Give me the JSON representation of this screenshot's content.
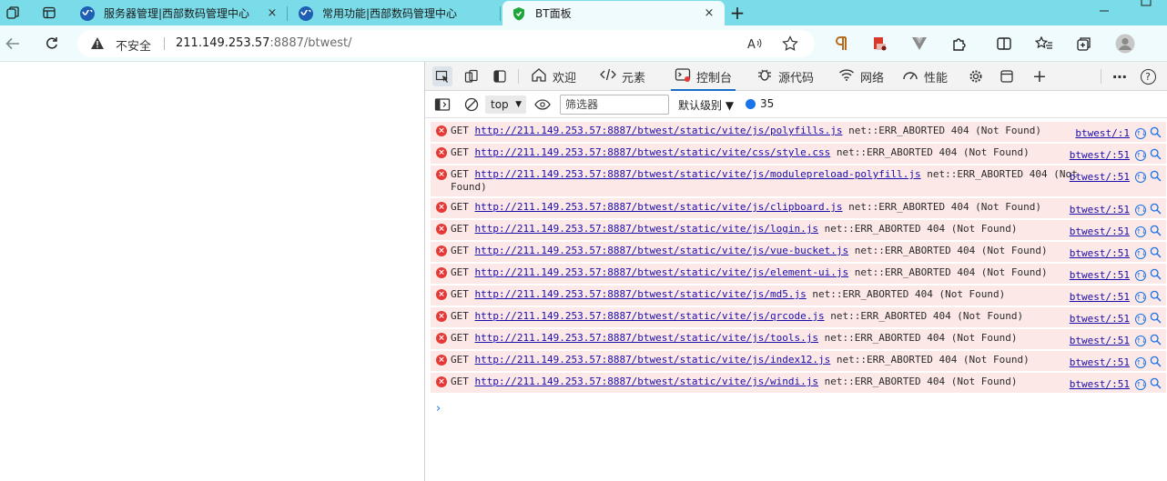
{
  "browser": {
    "tabs": [
      {
        "title": "服务器管理|西部数码管理中心",
        "favicon": "western-digital-favicon"
      },
      {
        "title": "常用功能|西部数码管理中心",
        "favicon": "western-digital-favicon"
      },
      {
        "title": "BT面板",
        "favicon": "bt-panel-favicon",
        "active": true
      }
    ],
    "close_glyph": "×",
    "new_tab_glyph": "+",
    "address": {
      "security_label": "不安全",
      "host": "211.149.253.57",
      "port_path": ":8887/btwest/"
    }
  },
  "devtools": {
    "tabs": [
      {
        "label": "欢迎",
        "icon": "home-icon"
      },
      {
        "label": "元素",
        "icon": "code-icon"
      },
      {
        "label": "控制台",
        "icon": "console-icon",
        "active": true
      },
      {
        "label": "源代码",
        "icon": "bug-icon"
      },
      {
        "label": "网络",
        "icon": "wifi-icon"
      },
      {
        "label": "性能",
        "icon": "gauge-icon"
      }
    ],
    "more_glyph": "⋯",
    "help_glyph": "?",
    "add_glyph": "+",
    "console_bar": {
      "context": "top",
      "filter_placeholder": "筛选器",
      "levels_label": "默认级别 ▼",
      "issues_count": "35"
    },
    "messages": [
      {
        "method": "GET",
        "url": "http://211.149.253.57:8887/btwest/static/vite/js/polyfills.js",
        "error": "net::ERR_ABORTED 404 (Not Found)",
        "source": "btwest/:1"
      },
      {
        "method": "GET",
        "url": "http://211.149.253.57:8887/btwest/static/vite/css/style.css",
        "error": "net::ERR_ABORTED 404 (Not Found)",
        "source": "btwest/:51"
      },
      {
        "method": "GET",
        "url": "http://211.149.253.57:8887/btwest/static/vite/js/modulepreload-polyfill.js",
        "error": "net::ERR_ABORTED 404 (Not Found)",
        "source": "btwest/:51"
      },
      {
        "method": "GET",
        "url": "http://211.149.253.57:8887/btwest/static/vite/js/clipboard.js",
        "error": "net::ERR_ABORTED 404 (Not Found)",
        "source": "btwest/:51"
      },
      {
        "method": "GET",
        "url": "http://211.149.253.57:8887/btwest/static/vite/js/login.js",
        "error": "net::ERR_ABORTED 404 (Not Found)",
        "source": "btwest/:51"
      },
      {
        "method": "GET",
        "url": "http://211.149.253.57:8887/btwest/static/vite/js/vue-bucket.js",
        "error": "net::ERR_ABORTED 404 (Not Found)",
        "source": "btwest/:51"
      },
      {
        "method": "GET",
        "url": "http://211.149.253.57:8887/btwest/static/vite/js/element-ui.js",
        "error": "net::ERR_ABORTED 404 (Not Found)",
        "source": "btwest/:51"
      },
      {
        "method": "GET",
        "url": "http://211.149.253.57:8887/btwest/static/vite/js/md5.js",
        "error": "net::ERR_ABORTED 404 (Not Found)",
        "source": "btwest/:51"
      },
      {
        "method": "GET",
        "url": "http://211.149.253.57:8887/btwest/static/vite/js/qrcode.js",
        "error": "net::ERR_ABORTED 404 (Not Found)",
        "source": "btwest/:51"
      },
      {
        "method": "GET",
        "url": "http://211.149.253.57:8887/btwest/static/vite/js/tools.js",
        "error": "net::ERR_ABORTED 404 (Not Found)",
        "source": "btwest/:51"
      },
      {
        "method": "GET",
        "url": "http://211.149.253.57:8887/btwest/static/vite/js/index12.js",
        "error": "net::ERR_ABORTED 404 (Not Found)",
        "source": "btwest/:51"
      },
      {
        "method": "GET",
        "url": "http://211.149.253.57:8887/btwest/static/vite/js/windi.js",
        "error": "net::ERR_ABORTED 404 (Not Found)",
        "source": "btwest/:51"
      }
    ],
    "prompt_glyph": "›"
  },
  "colors": {
    "tabstrip": "#7adce8",
    "toolbar": "#f0fbfd",
    "error_row": "#fce8e6",
    "error_icon": "#e53935",
    "link": "#1a0dab",
    "accent": "#1a6fc9"
  }
}
